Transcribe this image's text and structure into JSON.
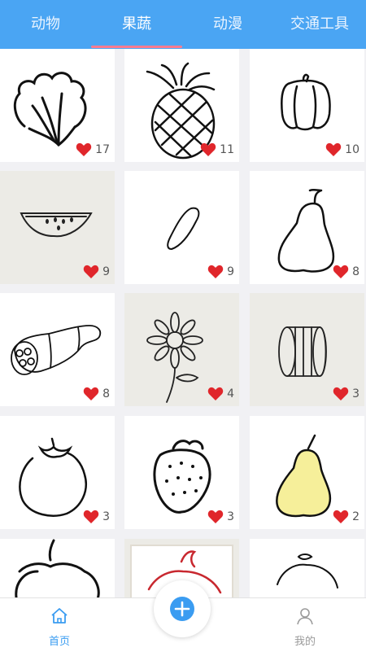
{
  "tabs": [
    "动物",
    "果蔬",
    "动漫",
    "交通工具"
  ],
  "active_tab": "果蔬",
  "cards": [
    {
      "subject": "lettuce",
      "likes": "17"
    },
    {
      "subject": "pineapple",
      "likes": "11"
    },
    {
      "subject": "bell-pepper",
      "likes": "10"
    },
    {
      "subject": "watermelon-slice",
      "likes": "9"
    },
    {
      "subject": "seed",
      "likes": "9"
    },
    {
      "subject": "pear",
      "likes": "8"
    },
    {
      "subject": "lotus-root",
      "likes": "8"
    },
    {
      "subject": "flower",
      "likes": "4"
    },
    {
      "subject": "lotus-root-slice",
      "likes": "3"
    },
    {
      "subject": "persimmon",
      "likes": "3"
    },
    {
      "subject": "strawberry",
      "likes": "3"
    },
    {
      "subject": "yellow-pear",
      "likes": "2"
    }
  ],
  "nav": {
    "home_label": "首页",
    "mine_label": "我的"
  },
  "colors": {
    "header": "#4aa5f3",
    "tab_indicator": "#ff7b8f",
    "heart": "#e0262b",
    "fab": "#3a9cf1"
  }
}
